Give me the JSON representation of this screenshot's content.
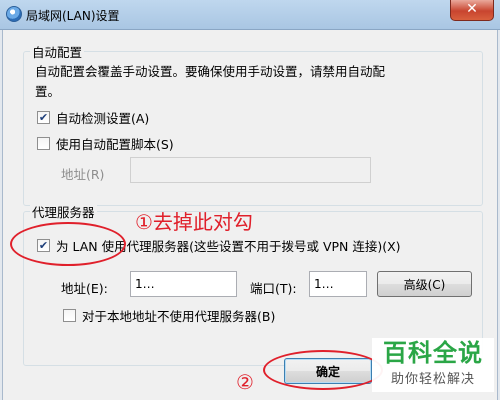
{
  "window": {
    "title": "局域网(LAN)设置",
    "close_glyph": "✕"
  },
  "auto_config": {
    "title": "自动配置",
    "description_line1": "自动配置会覆盖手动设置。要确保使用手动设置，请禁用自动配",
    "description_line2": "置。",
    "auto_detect": {
      "label": "自动检测设置(A)",
      "checked": true
    },
    "use_script": {
      "label": "使用自动配置脚本(S)",
      "checked": false
    },
    "address_label": "地址(R)",
    "address_value": ""
  },
  "proxy": {
    "title": "代理服务器",
    "use_proxy": {
      "label": "为 LAN 使用代理服务器(这些设置不用于拨号或 VPN 连接)(X)",
      "checked": true
    },
    "address_label": "地址(E):",
    "address_value": "1…",
    "port_label": "端口(T):",
    "port_value": "1…",
    "advanced_label": "高级(C)",
    "bypass_local": {
      "label": "对于本地地址不使用代理服务器(B)",
      "checked": false
    }
  },
  "buttons": {
    "ok_label": "确定"
  },
  "annotations": {
    "step1": "①去掉此对勾",
    "step2": "②",
    "color": "#e0202b"
  },
  "watermark": {
    "main": "百科全说",
    "sub": "助你轻松解决"
  }
}
